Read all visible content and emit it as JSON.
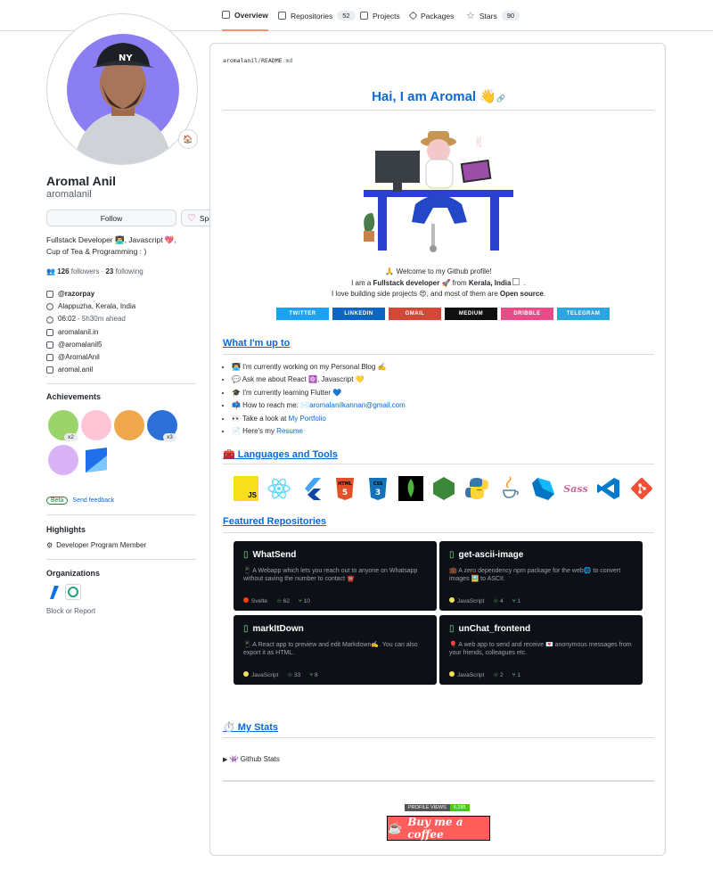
{
  "nav": {
    "tabs": [
      {
        "label": "Overview",
        "icon": "book-icon"
      },
      {
        "label": "Repositories",
        "count": "52",
        "icon": "repo-icon"
      },
      {
        "label": "Projects",
        "icon": "table-icon"
      },
      {
        "label": "Packages",
        "icon": "package-icon"
      },
      {
        "label": "Stars",
        "count": "90",
        "icon": "star-icon"
      }
    ]
  },
  "profile": {
    "name": "Aromal Anil",
    "username": "aromalanil",
    "follow_label": "Follow",
    "sponsor_label": "Sponsor",
    "bio_line1": "Fullstack Developer 👨‍💻, Javascript 💖,",
    "bio_line2": "Cup of Tea & Programming : )",
    "followers": "126",
    "followers_label": "followers",
    "following": "23",
    "following_label": "following",
    "company": "@razorpay",
    "location": "Alappuzha, Kerala, India",
    "time": "06:02",
    "time_note": "- 5h30m ahead",
    "website": "aromalanil.in",
    "twitter": "@aromalanil5",
    "youtube": "@AromalAnil",
    "instagram": "aromal.anil",
    "achievements_title": "Achievements",
    "ach_badges": [
      "x2",
      "x3"
    ],
    "beta": "Beta",
    "feedback": "Send feedback",
    "highlights_title": "Highlights",
    "highlight": "Developer Program Member",
    "orgs_title": "Organizations",
    "block": "Block or Report"
  },
  "readme": {
    "path_user": "aromalanil",
    "path_sep": "/",
    "path_file": "README",
    "path_ext": ".md",
    "title": "Hai, I am Aromal",
    "title_emoji": "👋",
    "welcome": "🙏 Welcome to my Github profile!",
    "iam_1": "I am a ",
    "iam_role": "Fullstack developer",
    "iam_2": " 🚀 from ",
    "iam_place": "Kerala, India",
    "iam_3": " .",
    "build_1": "I love building side projects 😍, and most of them are ",
    "build_2": "Open source",
    "build_3": ".",
    "badges": [
      {
        "label": "TWITTER",
        "color": "#1da1f2"
      },
      {
        "label": "LINKEDIN",
        "color": "#0a66c2"
      },
      {
        "label": "GMAIL",
        "color": "#d14836"
      },
      {
        "label": "MEDIUM",
        "color": "#12100e"
      },
      {
        "label": "DRIBBLE",
        "color": "#ea4c89"
      },
      {
        "label": "TELEGRAM",
        "color": "#2ca5e0"
      }
    ],
    "h_whatiam": "What I'm up to",
    "up_items": [
      "👨‍💻 I'm currently working on my Personal Blog ✍️",
      "💬 Ask me about React ⚛️, Javascript 💛",
      "🎓 I'm currently learning Flutter 💙"
    ],
    "reach_pre": "📫 How to reach me: ✉️",
    "reach_link": "aromalanilkannan@gmail.com",
    "portfolio_pre": "👀 Take a look at ",
    "portfolio_link": "My Portfolio",
    "resume_pre": "📄 Here's my ",
    "resume_link": "Resume",
    "h_tools": "🧰 Languages and Tools",
    "tools": [
      "js",
      "react",
      "flutter",
      "html5",
      "css3",
      "mongodb",
      "nodejs",
      "python",
      "java",
      "dart",
      "sass",
      "vscode",
      "git"
    ],
    "tool_text": {
      "js": "JS",
      "html5": "HTML",
      "css3": "CSS",
      "sass": "Sass"
    },
    "h_repos": "Featured Repositories",
    "repos": [
      {
        "name": "WhatSend",
        "desc": "📱 A Webapp which lets you reach out to anyone on Whatsapp without saving the number to contact ☎️",
        "lang": "Svelte",
        "lang_color": "#ff3e00",
        "stars": "62",
        "forks": "10"
      },
      {
        "name": "get-ascii-image",
        "desc": "💼 A zero dependency npm package for the web🌐 to convert images 🖼️ to ASCII.",
        "lang": "JavaScript",
        "lang_color": "#f1e05a",
        "stars": "4",
        "forks": "1"
      },
      {
        "name": "markItDown",
        "desc": "📱 A React app to preview and edit Markdown✍️. You can also export it as HTML.",
        "lang": "JavaScript",
        "lang_color": "#f1e05a",
        "stars": "33",
        "forks": "8"
      },
      {
        "name": "unChat_frontend",
        "desc": "🎈 A web app to send and receive 💌 anonymous messages from your friends, colleagues etc.",
        "lang": "JavaScript",
        "lang_color": "#f1e05a",
        "stars": "2",
        "forks": "1"
      }
    ],
    "h_stats": "⏱️ My Stats",
    "stats_summary": "👾 Github Stats",
    "pv_label": "PROFILE VIEWS",
    "pv_value": "6,285",
    "coffee": "Buy me a coffee"
  }
}
